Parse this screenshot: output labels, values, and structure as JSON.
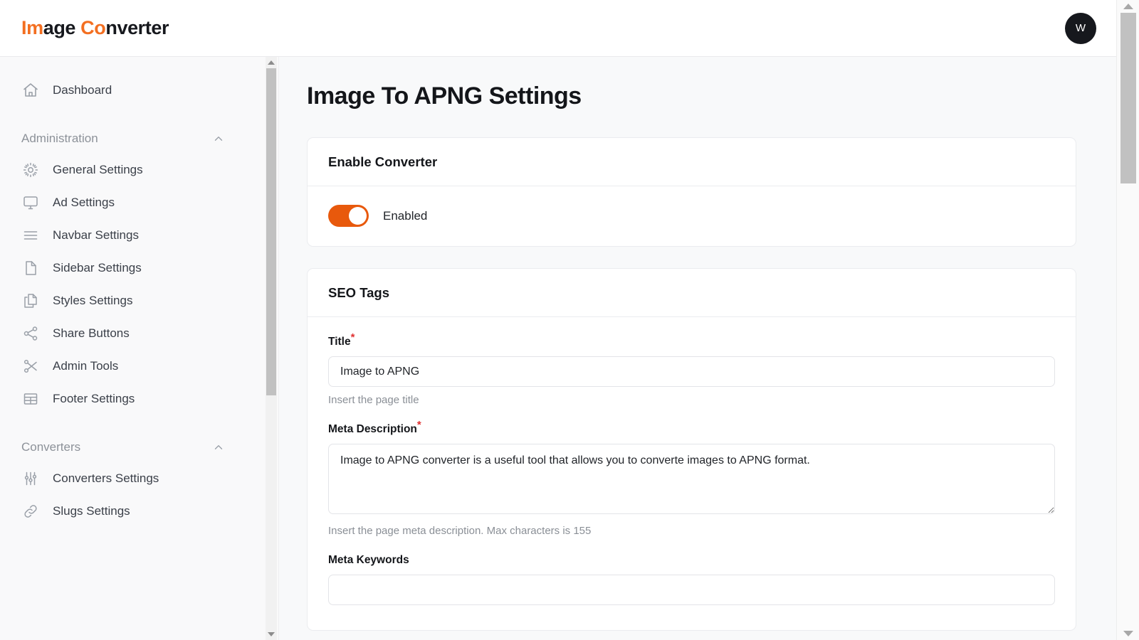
{
  "header": {
    "brand_part1": "Im",
    "brand_part2": "age ",
    "brand_part3": "Co",
    "brand_part4": "nverter",
    "avatar_initial": "W"
  },
  "sidebar": {
    "top_items": [
      {
        "label": "Dashboard",
        "icon": "home-icon"
      }
    ],
    "groups": [
      {
        "title": "Administration",
        "chevron": "chevron-up-icon",
        "items": [
          {
            "label": "General Settings",
            "icon": "gear-icon"
          },
          {
            "label": "Ad Settings",
            "icon": "monitor-icon"
          },
          {
            "label": "Navbar Settings",
            "icon": "menu-lines-icon"
          },
          {
            "label": "Sidebar Settings",
            "icon": "document-icon"
          },
          {
            "label": "Styles Settings",
            "icon": "copy-icon"
          },
          {
            "label": "Share Buttons",
            "icon": "share-icon"
          },
          {
            "label": "Admin Tools",
            "icon": "scissors-icon"
          },
          {
            "label": "Footer Settings",
            "icon": "table-icon"
          }
        ]
      },
      {
        "title": "Converters",
        "chevron": "chevron-up-icon",
        "items": [
          {
            "label": "Converters Settings",
            "icon": "sliders-icon"
          },
          {
            "label": "Slugs Settings",
            "icon": "link-icon"
          }
        ]
      }
    ]
  },
  "main": {
    "page_title": "Image To APNG Settings",
    "cards": [
      {
        "heading": "Enable Converter",
        "toggle": {
          "state_label": "Enabled",
          "on": true,
          "color": "#e8590c"
        }
      },
      {
        "heading": "SEO Tags",
        "fields": [
          {
            "label": "Title",
            "required": true,
            "required_marker": "*",
            "type": "input",
            "value": "Image to APNG",
            "placeholder": "",
            "hint": "Insert the page title"
          },
          {
            "label": "Meta Description",
            "required": true,
            "required_marker": "*",
            "type": "textarea",
            "value": "Image to APNG converter is a useful tool that allows you to converte images to APNG format.",
            "placeholder": "",
            "hint": "Insert the page meta description. Max characters is 155"
          },
          {
            "label": "Meta Keywords",
            "required": false,
            "required_marker": "",
            "type": "input",
            "value": "",
            "placeholder": "",
            "hint": ""
          }
        ]
      }
    ]
  },
  "colors": {
    "accent": "#f36f21",
    "toggle_on": "#e8590c",
    "required": "#e03131",
    "text_primary": "#14161a",
    "text_muted": "#8a8f96",
    "sidebar_bg": "#f9f9fa",
    "main_bg": "#f8f9fa",
    "card_border": "#ebecef"
  }
}
